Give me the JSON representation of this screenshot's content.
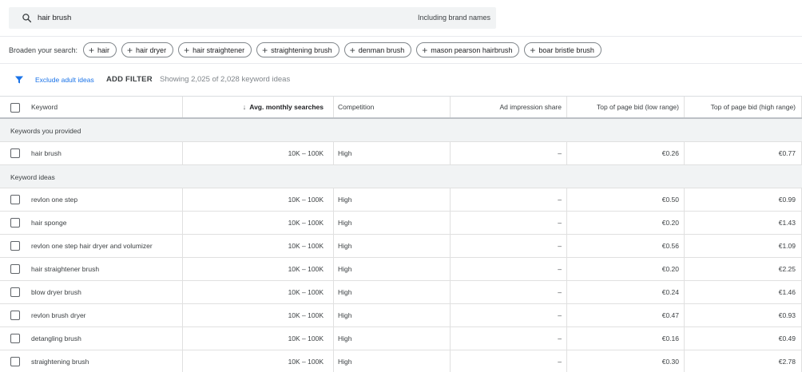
{
  "search": {
    "query": "hair brush",
    "brand_toggle": "Including brand names",
    "icon": "search-icon"
  },
  "broaden": {
    "label": "Broaden your search:",
    "chips": [
      "hair",
      "hair dryer",
      "hair straightener",
      "straightening brush",
      "denman brush",
      "mason pearson hairbrush",
      "boar bristle brush"
    ]
  },
  "filters": {
    "exclude_adult": "Exclude adult ideas",
    "add_filter": "ADD FILTER",
    "showing": "Showing 2,025 of 2,028 keyword ideas",
    "funnel_color": "#1a73e8"
  },
  "table": {
    "headers": {
      "keyword": "Keyword",
      "avg": "Avg. monthly searches",
      "competition": "Competition",
      "impression": "Ad impression share",
      "low": "Top of page bid (low range)",
      "high": "Top of page bid (high range)"
    },
    "sections": [
      {
        "title": "Keywords you provided",
        "rows": [
          {
            "keyword": "hair brush",
            "avg": "10K – 100K",
            "competition": "High",
            "impression": "–",
            "low": "€0.26",
            "high": "€0.77"
          }
        ]
      },
      {
        "title": "Keyword ideas",
        "rows": [
          {
            "keyword": "revlon one step",
            "avg": "10K – 100K",
            "competition": "High",
            "impression": "–",
            "low": "€0.50",
            "high": "€0.99"
          },
          {
            "keyword": "hair sponge",
            "avg": "10K – 100K",
            "competition": "High",
            "impression": "–",
            "low": "€0.20",
            "high": "€1.43"
          },
          {
            "keyword": "revlon one step hair dryer and volumizer",
            "avg": "10K – 100K",
            "competition": "High",
            "impression": "–",
            "low": "€0.56",
            "high": "€1.09"
          },
          {
            "keyword": "hair straightener brush",
            "avg": "10K – 100K",
            "competition": "High",
            "impression": "–",
            "low": "€0.20",
            "high": "€2.25"
          },
          {
            "keyword": "blow dryer brush",
            "avg": "10K – 100K",
            "competition": "High",
            "impression": "–",
            "low": "€0.24",
            "high": "€1.46"
          },
          {
            "keyword": "revlon brush dryer",
            "avg": "10K – 100K",
            "competition": "High",
            "impression": "–",
            "low": "€0.47",
            "high": "€0.93"
          },
          {
            "keyword": "detangling brush",
            "avg": "10K – 100K",
            "competition": "High",
            "impression": "–",
            "low": "€0.16",
            "high": "€0.49"
          },
          {
            "keyword": "straightening brush",
            "avg": "10K – 100K",
            "competition": "High",
            "impression": "–",
            "low": "€0.30",
            "high": "€2.78"
          }
        ]
      }
    ]
  }
}
